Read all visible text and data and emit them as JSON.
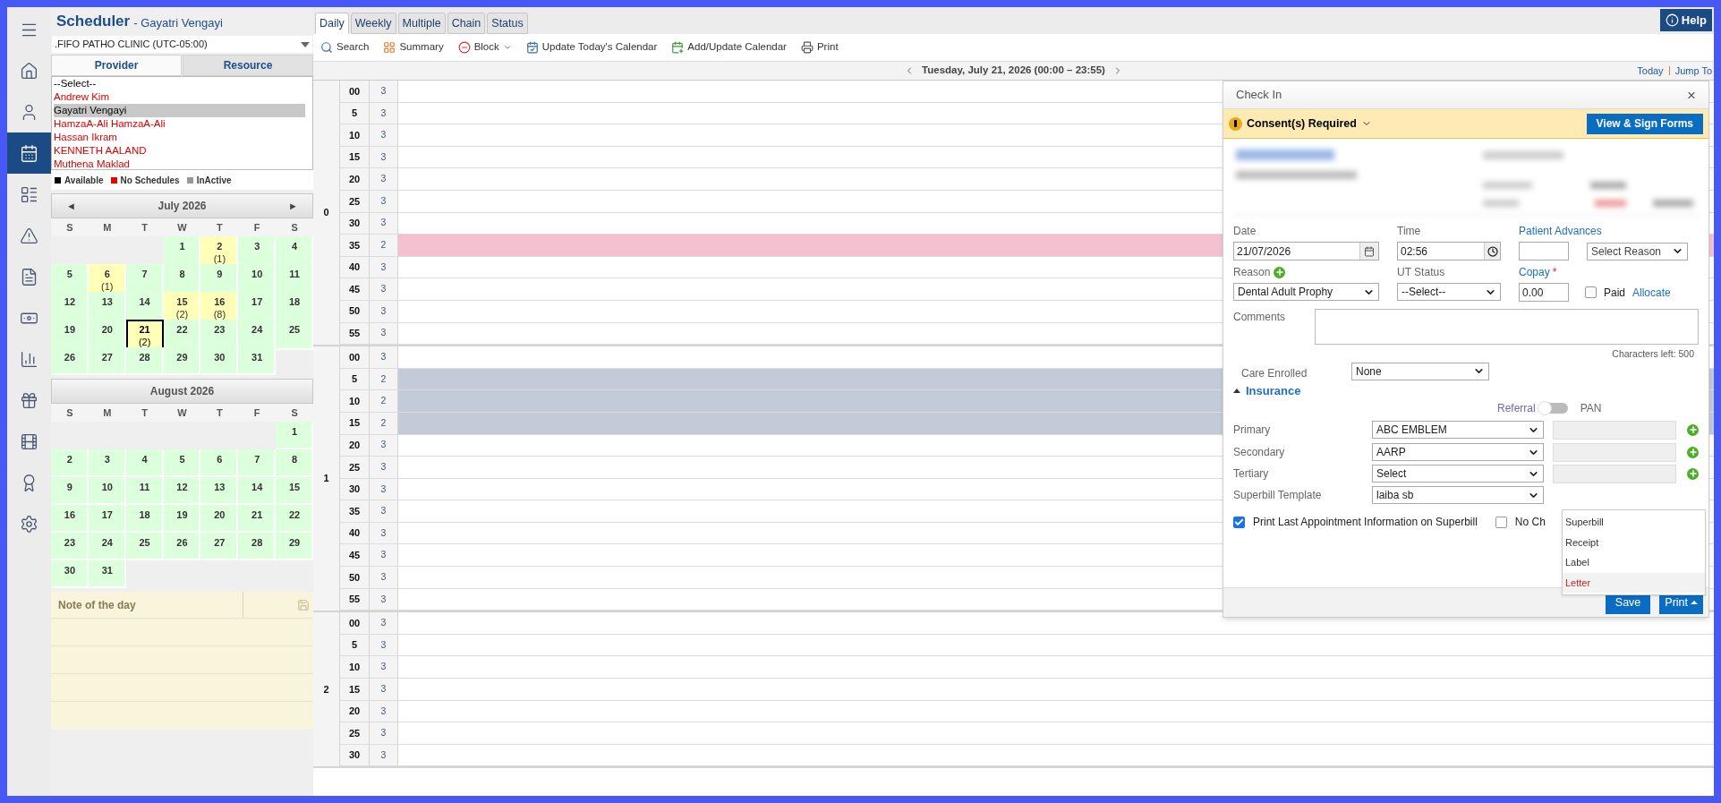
{
  "rail": [
    {
      "selected": false
    },
    {
      "selected": false
    },
    {
      "selected": false
    },
    {
      "selected": true
    },
    {
      "selected": false
    },
    {
      "selected": false
    },
    {
      "selected": false
    },
    {
      "selected": false
    },
    {
      "selected": false
    },
    {
      "selected": false
    },
    {
      "selected": false
    },
    {
      "selected": false
    },
    {
      "selected": false
    }
  ],
  "header": {
    "title": "Scheduler",
    "subtitle": "- Gayatri Vengayi"
  },
  "clinic": {
    "value": ".FIFO PATHO CLINIC (UTC-05:00)"
  },
  "list_tabs": [
    {
      "label": "Provider",
      "selected": true
    },
    {
      "label": "Resource",
      "selected": false
    }
  ],
  "providers": [
    {
      "name": "--Select--",
      "color": "#000000",
      "selected": false
    },
    {
      "name": "Andrew Kim",
      "color": "#e00000",
      "selected": false
    },
    {
      "name": "Gayatri Vengayi",
      "color": "#000000",
      "selected": true
    },
    {
      "name": "HamzaA-Ali HamzaA-Ali",
      "color": "#e00000",
      "selected": false
    },
    {
      "name": "Hassan Ikram",
      "color": "#e00000",
      "selected": false
    },
    {
      "name": "KENNETH AALAND",
      "color": "#e00000",
      "selected": false
    },
    {
      "name": "Muthena Maklad",
      "color": "#e00000",
      "selected": false
    }
  ],
  "legend": [
    {
      "label": "Available",
      "color": "#000000"
    },
    {
      "label": "No Schedules",
      "color": "#ee0000"
    },
    {
      "label": "InActive",
      "color": "#999999"
    }
  ],
  "months": [
    {
      "title": "July 2026",
      "prev": "◄",
      "next": "►",
      "weekdays": [
        "S",
        "M",
        "T",
        "W",
        "T",
        "F",
        "S"
      ],
      "weeks": [
        [
          {
            "kind": "blank"
          },
          {
            "kind": "blank"
          },
          {
            "kind": "blank"
          },
          {
            "day": "1",
            "kind": "open",
            "selected": false
          },
          {
            "day": "2",
            "count": "(1)",
            "kind": "booked",
            "selected": false
          },
          {
            "day": "3",
            "kind": "open",
            "selected": false
          },
          {
            "day": "4",
            "kind": "open",
            "selected": false
          }
        ],
        [
          {
            "day": "5",
            "kind": "open",
            "selected": false
          },
          {
            "day": "6",
            "count": "(1)",
            "kind": "booked",
            "selected": false
          },
          {
            "day": "7",
            "kind": "open",
            "selected": false
          },
          {
            "day": "8",
            "kind": "open",
            "selected": false
          },
          {
            "day": "9",
            "kind": "open",
            "selected": false
          },
          {
            "day": "10",
            "kind": "open",
            "selected": false
          },
          {
            "day": "11",
            "kind": "open",
            "selected": false
          }
        ],
        [
          {
            "day": "12",
            "kind": "open",
            "selected": false
          },
          {
            "day": "13",
            "kind": "open",
            "selected": false
          },
          {
            "day": "14",
            "kind": "open",
            "selected": false
          },
          {
            "day": "15",
            "count": "(2)",
            "kind": "booked",
            "selected": false
          },
          {
            "day": "16",
            "count": "(8)",
            "kind": "booked",
            "selected": false
          },
          {
            "day": "17",
            "kind": "open",
            "selected": false
          },
          {
            "day": "18",
            "kind": "open",
            "selected": false
          }
        ],
        [
          {
            "day": "19",
            "kind": "open",
            "selected": false
          },
          {
            "day": "20",
            "kind": "open",
            "selected": false
          },
          {
            "day": "21",
            "count": "(2)",
            "kind": "booked",
            "selected": true
          },
          {
            "day": "22",
            "kind": "open",
            "selected": false
          },
          {
            "day": "23",
            "kind": "open",
            "selected": false
          },
          {
            "day": "24",
            "kind": "open",
            "selected": false
          },
          {
            "day": "25",
            "kind": "open",
            "selected": false
          }
        ],
        [
          {
            "day": "26",
            "kind": "open",
            "selected": false
          },
          {
            "day": "27",
            "kind": "open",
            "selected": false
          },
          {
            "day": "28",
            "kind": "open",
            "selected": false
          },
          {
            "day": "29",
            "kind": "open",
            "selected": false
          },
          {
            "day": "30",
            "kind": "open",
            "selected": false
          },
          {
            "day": "31",
            "kind": "open",
            "selected": false
          },
          {
            "kind": "blank"
          }
        ]
      ]
    },
    {
      "title": "August 2026",
      "weekdays": [
        "S",
        "M",
        "T",
        "W",
        "T",
        "F",
        "S"
      ],
      "weeks": [
        [
          {
            "kind": "blank"
          },
          {
            "kind": "blank"
          },
          {
            "kind": "blank"
          },
          {
            "kind": "blank"
          },
          {
            "kind": "blank"
          },
          {
            "kind": "blank"
          },
          {
            "day": "1",
            "kind": "open",
            "selected": false
          }
        ],
        [
          {
            "day": "2",
            "kind": "open",
            "selected": false
          },
          {
            "day": "3",
            "kind": "open",
            "selected": false
          },
          {
            "day": "4",
            "kind": "open",
            "selected": false
          },
          {
            "day": "5",
            "kind": "open",
            "selected": false
          },
          {
            "day": "6",
            "kind": "open",
            "selected": false
          },
          {
            "day": "7",
            "kind": "open",
            "selected": false
          },
          {
            "day": "8",
            "kind": "open",
            "selected": false
          }
        ],
        [
          {
            "day": "9",
            "kind": "open",
            "selected": false
          },
          {
            "day": "10",
            "kind": "open",
            "selected": false
          },
          {
            "day": "11",
            "kind": "open",
            "selected": false
          },
          {
            "day": "12",
            "kind": "open",
            "selected": false
          },
          {
            "day": "13",
            "kind": "open",
            "selected": false
          },
          {
            "day": "14",
            "kind": "open",
            "selected": false
          },
          {
            "day": "15",
            "kind": "open",
            "selected": false
          }
        ],
        [
          {
            "day": "16",
            "kind": "open",
            "selected": false
          },
          {
            "day": "17",
            "kind": "open",
            "selected": false
          },
          {
            "day": "18",
            "kind": "open",
            "selected": false
          },
          {
            "day": "19",
            "kind": "open",
            "selected": false
          },
          {
            "day": "20",
            "kind": "open",
            "selected": false
          },
          {
            "day": "21",
            "kind": "open",
            "selected": false
          },
          {
            "day": "22",
            "kind": "open",
            "selected": false
          }
        ],
        [
          {
            "day": "23",
            "kind": "open",
            "selected": false
          },
          {
            "day": "24",
            "kind": "open",
            "selected": false
          },
          {
            "day": "25",
            "kind": "open",
            "selected": false
          },
          {
            "day": "26",
            "kind": "open",
            "selected": false
          },
          {
            "day": "27",
            "kind": "open",
            "selected": false
          },
          {
            "day": "28",
            "kind": "open",
            "selected": false
          },
          {
            "day": "29",
            "kind": "open",
            "selected": false
          }
        ],
        [
          {
            "day": "30",
            "kind": "open",
            "selected": false
          },
          {
            "day": "31",
            "kind": "open",
            "selected": false
          },
          {
            "kind": "blank"
          },
          {
            "kind": "blank"
          },
          {
            "kind": "blank"
          },
          {
            "kind": "blank"
          },
          {
            "kind": "blank"
          }
        ]
      ]
    }
  ],
  "note": {
    "title": "Note of the day"
  },
  "view_tabs": [
    {
      "label": "Daily",
      "selected": true
    },
    {
      "label": "Weekly",
      "selected": false
    },
    {
      "label": "Multiple",
      "selected": false
    },
    {
      "label": "Chain",
      "selected": false
    },
    {
      "label": "Status",
      "selected": false
    }
  ],
  "help": {
    "label": "Help"
  },
  "toolbar": [
    {
      "label": "Search"
    },
    {
      "label": "Summary"
    },
    {
      "label": "Block"
    },
    {
      "label": "Update Today's Calendar"
    },
    {
      "label": "Add/Update Calendar"
    },
    {
      "label": "Print"
    }
  ],
  "date_nav": {
    "title": "Tuesday, July 21, 2026 (00:00 – 23:55)",
    "links": [
      "Today",
      "Jump To"
    ]
  },
  "schedule": [
    {
      "hour": "0",
      "slots": [
        {
          "minute": "00",
          "count": "3"
        },
        {
          "minute": "5",
          "count": "3"
        },
        {
          "minute": "10",
          "count": "3"
        },
        {
          "minute": "15",
          "count": "3"
        },
        {
          "minute": "20",
          "count": "3"
        },
        {
          "minute": "25",
          "count": "3"
        },
        {
          "minute": "30",
          "count": "3"
        },
        {
          "minute": "35",
          "count": "2",
          "color": "#f4c1d0"
        },
        {
          "minute": "40",
          "count": "3"
        },
        {
          "minute": "45",
          "count": "3"
        },
        {
          "minute": "50",
          "count": "3"
        },
        {
          "minute": "55",
          "count": "3"
        }
      ]
    },
    {
      "hour": "1",
      "slots": [
        {
          "minute": "00",
          "count": "3"
        },
        {
          "minute": "5",
          "count": "2",
          "color": "#c3cad8"
        },
        {
          "minute": "10",
          "count": "2",
          "color": "#c3cad8"
        },
        {
          "minute": "15",
          "count": "2",
          "color": "#c3cad8"
        },
        {
          "minute": "20",
          "count": "3"
        },
        {
          "minute": "25",
          "count": "3"
        },
        {
          "minute": "30",
          "count": "3"
        },
        {
          "minute": "35",
          "count": "3"
        },
        {
          "minute": "40",
          "count": "3"
        },
        {
          "minute": "45",
          "count": "3"
        },
        {
          "minute": "50",
          "count": "3"
        },
        {
          "minute": "55",
          "count": "3"
        }
      ]
    },
    {
      "hour": "2",
      "slots": [
        {
          "minute": "00",
          "count": "3"
        },
        {
          "minute": "5",
          "count": "3"
        },
        {
          "minute": "10",
          "count": "3"
        },
        {
          "minute": "15",
          "count": "3"
        },
        {
          "minute": "20",
          "count": "3"
        },
        {
          "minute": "25",
          "count": "3"
        },
        {
          "minute": "30",
          "count": "3"
        }
      ]
    }
  ],
  "checkin": {
    "title": "Check In",
    "close": "×",
    "consent": {
      "label": "Consent(s) Required",
      "button": "View & Sign Forms"
    },
    "date": {
      "label": "Date",
      "value": "21/07/2026"
    },
    "time": {
      "label": "Time",
      "value": "02:56"
    },
    "advances": {
      "label": "Patient Advances",
      "reason": "Select Reason"
    },
    "reason": {
      "label": "Reason",
      "value": "Dental Adult Prophy"
    },
    "ut_status": {
      "label": "UT Status",
      "value": "--Select--"
    },
    "copay": {
      "label": "Copay",
      "required": "*",
      "value": "0.00"
    },
    "paid": {
      "label": "Paid",
      "checked": false
    },
    "allocate": "Allocate",
    "comments": {
      "label": "Comments",
      "counter": "Characters left: 500"
    },
    "care_enrolled": {
      "label": "Care Enrolled",
      "value": "None"
    },
    "insurance": {
      "label": "Insurance",
      "expanded": true,
      "referral": "Referral",
      "pan": "PAN",
      "toggle_on": false,
      "rows": [
        {
          "label": "Primary",
          "value": "ABC EMBLEM"
        },
        {
          "label": "Secondary",
          "value": "AARP"
        },
        {
          "label": "Tertiary",
          "value": "Select"
        }
      ]
    },
    "superbill": {
      "label": "Superbill Template",
      "value": "laiba sb"
    },
    "print_last": {
      "label": "Print Last Appointment Information on Superbill",
      "checked": true
    },
    "no_charge": {
      "label": "No Ch",
      "checked": false
    },
    "print_menu": [
      {
        "label": "Superbill",
        "selected": false
      },
      {
        "label": "Receipt",
        "selected": false
      },
      {
        "label": "Label",
        "selected": false
      },
      {
        "label": "Letter",
        "selected": true
      }
    ],
    "save": "Save",
    "print": "Print"
  }
}
